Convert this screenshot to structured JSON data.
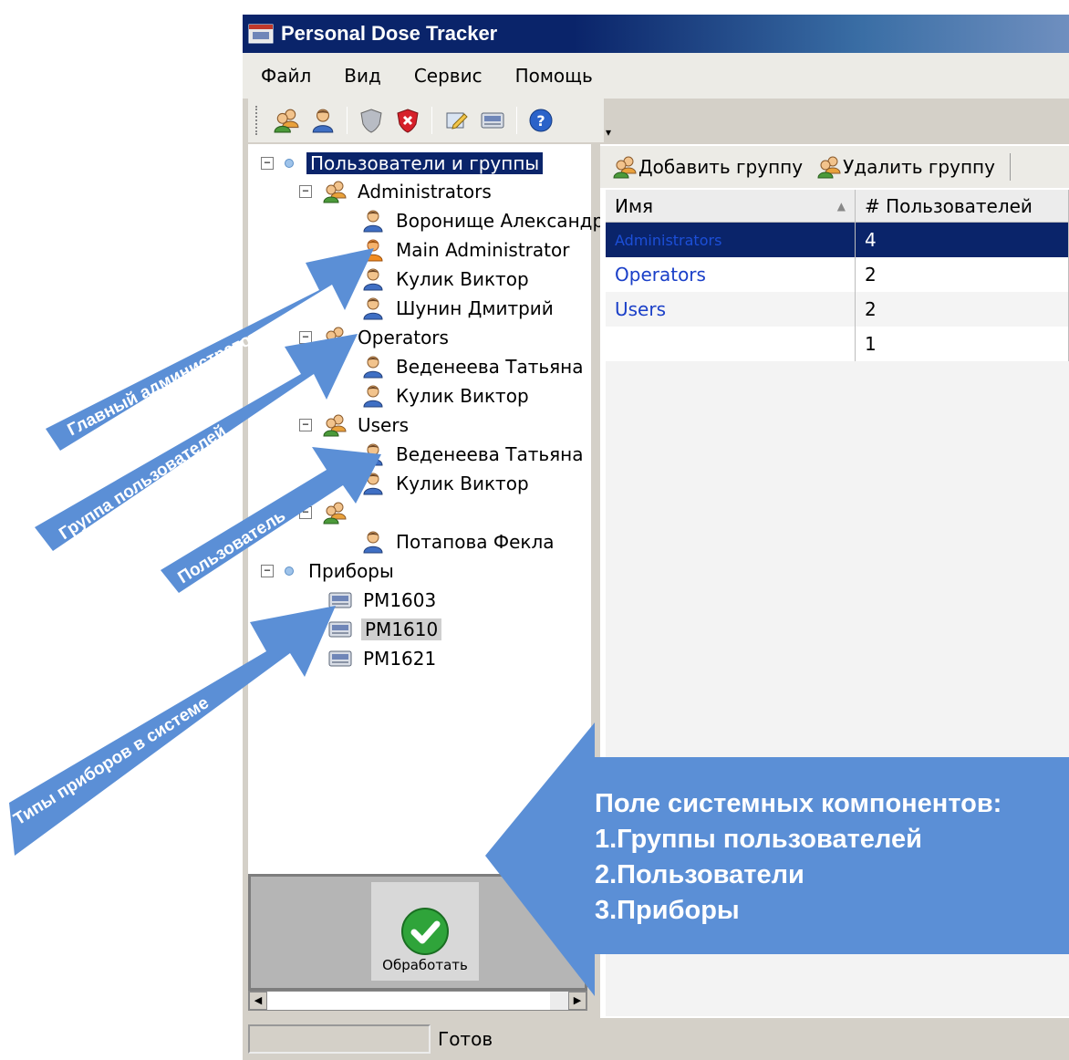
{
  "window": {
    "title": "Personal Dose Tracker"
  },
  "menu": [
    "Файл",
    "Вид",
    "Сервис",
    "Помощь"
  ],
  "toolbar_icons": [
    "add-group-icon",
    "add-user-icon",
    "shield-icon",
    "shield-remove-icon",
    "edit-icon",
    "device-icon",
    "help-icon"
  ],
  "tree": {
    "root_users": "Пользователи и группы",
    "groups": [
      {
        "name": "Administrators",
        "users": [
          "Воронище Александр",
          "Main Administrator",
          "Кулик Виктор",
          "Шунин Дмитрий"
        ]
      },
      {
        "name": "Operators",
        "users": [
          "Веденеева Татьяна",
          "Кулик Виктор"
        ]
      },
      {
        "name": "Users",
        "users": [
          "Веденеева Татьяна",
          "Кулик Виктор"
        ]
      },
      {
        "name": "",
        "users": [
          "Потапова Фекла"
        ]
      }
    ],
    "root_devices": "Приборы",
    "devices": [
      "PM1603",
      "PM1610",
      "PM1621"
    ]
  },
  "action": {
    "process_label": "Обработать"
  },
  "right_toolbar": {
    "add_group": "Добавить группу",
    "remove_group": "Удалить группу"
  },
  "grid": {
    "columns": [
      "Имя",
      "# Пользователей"
    ],
    "rows": [
      {
        "name": "Administrators",
        "count": "4"
      },
      {
        "name": "Operators",
        "count": "2"
      },
      {
        "name": "Users",
        "count": "2"
      },
      {
        "name": "",
        "count": "1"
      }
    ]
  },
  "status": {
    "text": "Готов"
  },
  "annotations": {
    "arrow1": "Главный администратор",
    "arrow2": "Группа пользователей",
    "arrow3": "Пользователь",
    "arrow4": "Типы приборов в системе",
    "big": {
      "title": "Поле системных компонентов:",
      "item1": "1.Группы пользователей",
      "item2": "2.Пользователи",
      "item3": "3.Приборы"
    }
  },
  "colors": {
    "titlebar": "#0a246a",
    "selection": "#0a246a",
    "callout": "#5b8fd6"
  }
}
